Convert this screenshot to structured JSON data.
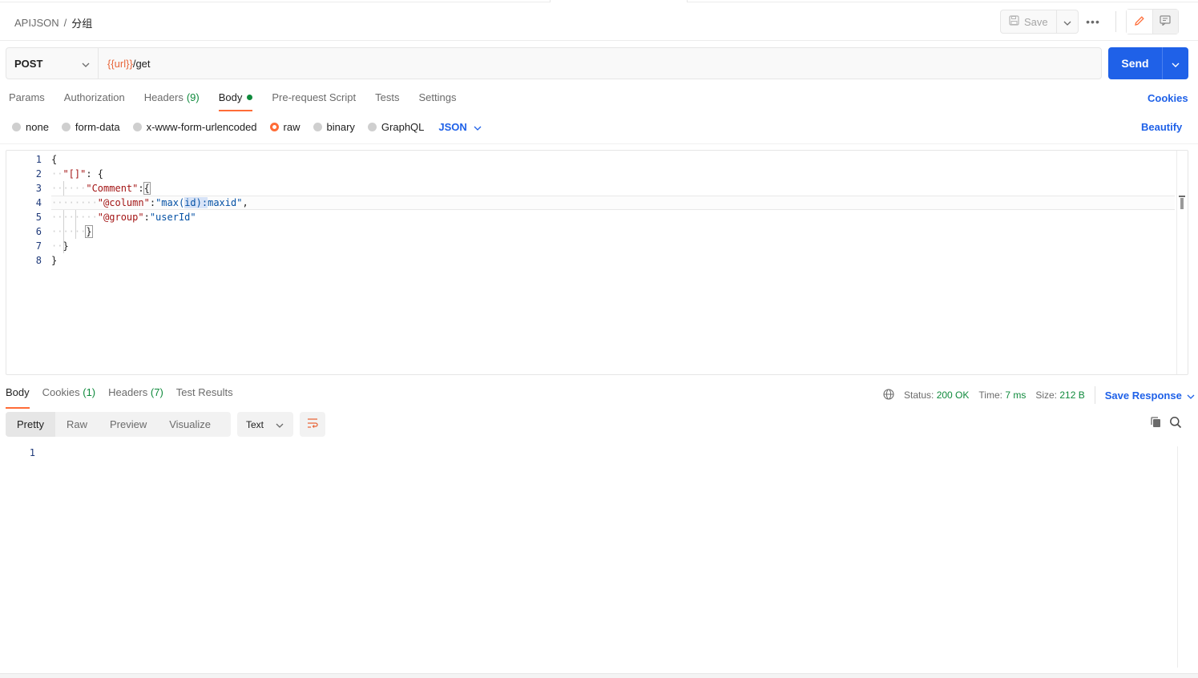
{
  "breadcrumb": {
    "root": "APIJSON",
    "separator": "/",
    "current": "分组"
  },
  "header": {
    "save_label": "Save",
    "more_label": "•••"
  },
  "request": {
    "method": "POST",
    "url_var": "{{url}}",
    "url_path": "/get",
    "send_label": "Send"
  },
  "request_tabs": {
    "params": "Params",
    "authorization": "Authorization",
    "headers": "Headers",
    "headers_count": "(9)",
    "body": "Body",
    "prerequest": "Pre-request Script",
    "tests": "Tests",
    "settings": "Settings",
    "cookies": "Cookies"
  },
  "body_types": {
    "none": "none",
    "form_data": "form-data",
    "urlencoded": "x-www-form-urlencoded",
    "raw": "raw",
    "binary": "binary",
    "graphql": "GraphQL",
    "language": "JSON",
    "beautify": "Beautify"
  },
  "editor": {
    "line_numbers": [
      "1",
      "2",
      "3",
      "4",
      "5",
      "6",
      "7",
      "8"
    ],
    "l1": "{",
    "l2_key": "\"[]\"",
    "l2_rest": ": {",
    "l3_key": "\"Comment\"",
    "l3_colon": ":",
    "l3_brace": "{",
    "l4_key": "\"@column\"",
    "l4_colon": ":",
    "l4_str_a": "\"max(",
    "l4_str_sel": "id):",
    "l4_str_b": "maxid\"",
    "l4_comma": ",",
    "l5_key": "\"@group\"",
    "l5_colon": ":",
    "l5_str": "\"userId\"",
    "l6": "}",
    "l7": "}",
    "l8": "}"
  },
  "response_tabs": {
    "body": "Body",
    "cookies": "Cookies",
    "cookies_count": "(1)",
    "headers": "Headers",
    "headers_count": "(7)",
    "test_results": "Test Results"
  },
  "response_meta": {
    "status_label": "Status:",
    "status_value": "200 OK",
    "time_label": "Time:",
    "time_value": "7 ms",
    "size_label": "Size:",
    "size_value": "212 B",
    "save_response": "Save Response"
  },
  "response_view": {
    "pretty": "Pretty",
    "raw": "Raw",
    "preview": "Preview",
    "visualize": "Visualize",
    "format": "Text",
    "line_numbers": [
      "1"
    ]
  },
  "colors": {
    "accent": "#ff6c37",
    "primary": "#1f61e8",
    "success": "#0f8a3c",
    "var": "#e8663a"
  }
}
